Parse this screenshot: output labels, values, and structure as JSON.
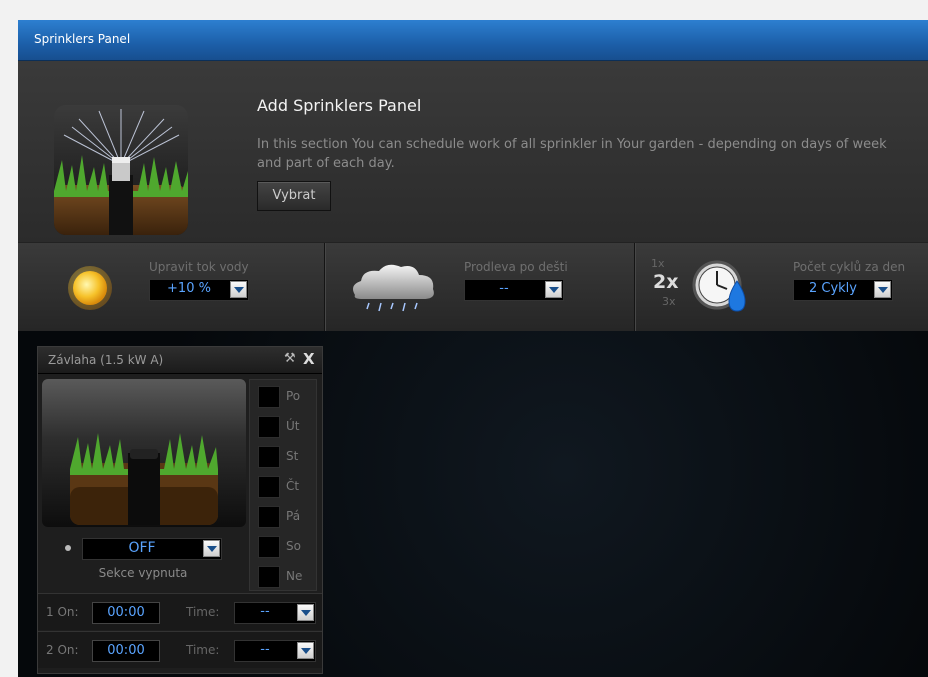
{
  "window": {
    "title": "Sprinklers Panel"
  },
  "intro": {
    "heading": "Add Sprinklers Panel",
    "description": "In this section You can schedule work of all sprinkler in Your garden - depending on days of week and part of each day.",
    "button_label": "Vybrat"
  },
  "controls": {
    "flow": {
      "label": "Upravit tok vody",
      "value": "+10 %"
    },
    "rain_delay": {
      "label": "Prodleva po dešti",
      "value": "--"
    },
    "cycles": {
      "label": "Počet cyklů za den",
      "value": "2 Cykly",
      "icon_top": "1x",
      "icon_mid": "2x",
      "icon_bot": "3x"
    }
  },
  "widget": {
    "title": "Závlaha (1.5 kW A)",
    "days": [
      "Po",
      "Út",
      "St",
      "Čt",
      "Pá",
      "So",
      "Ne"
    ],
    "status_value": "OFF",
    "status_text": "Sekce vypnuta",
    "schedule": [
      {
        "on_label": "1 On:",
        "time_value": "00:00",
        "duration_label": "Time:",
        "duration_value": "--"
      },
      {
        "on_label": "2 On:",
        "time_value": "00:00",
        "duration_label": "Time:",
        "duration_value": "--"
      }
    ]
  },
  "colors": {
    "titlebar": "#1c5fa9",
    "value_text": "#5aa4ff",
    "background": "#0e0e0e"
  },
  "icons": [
    "sprinkler-icon",
    "sun-icon",
    "rain-cloud-icon",
    "clock-water-icon",
    "wrench-icon",
    "close-icon",
    "chevron-down-icon"
  ]
}
